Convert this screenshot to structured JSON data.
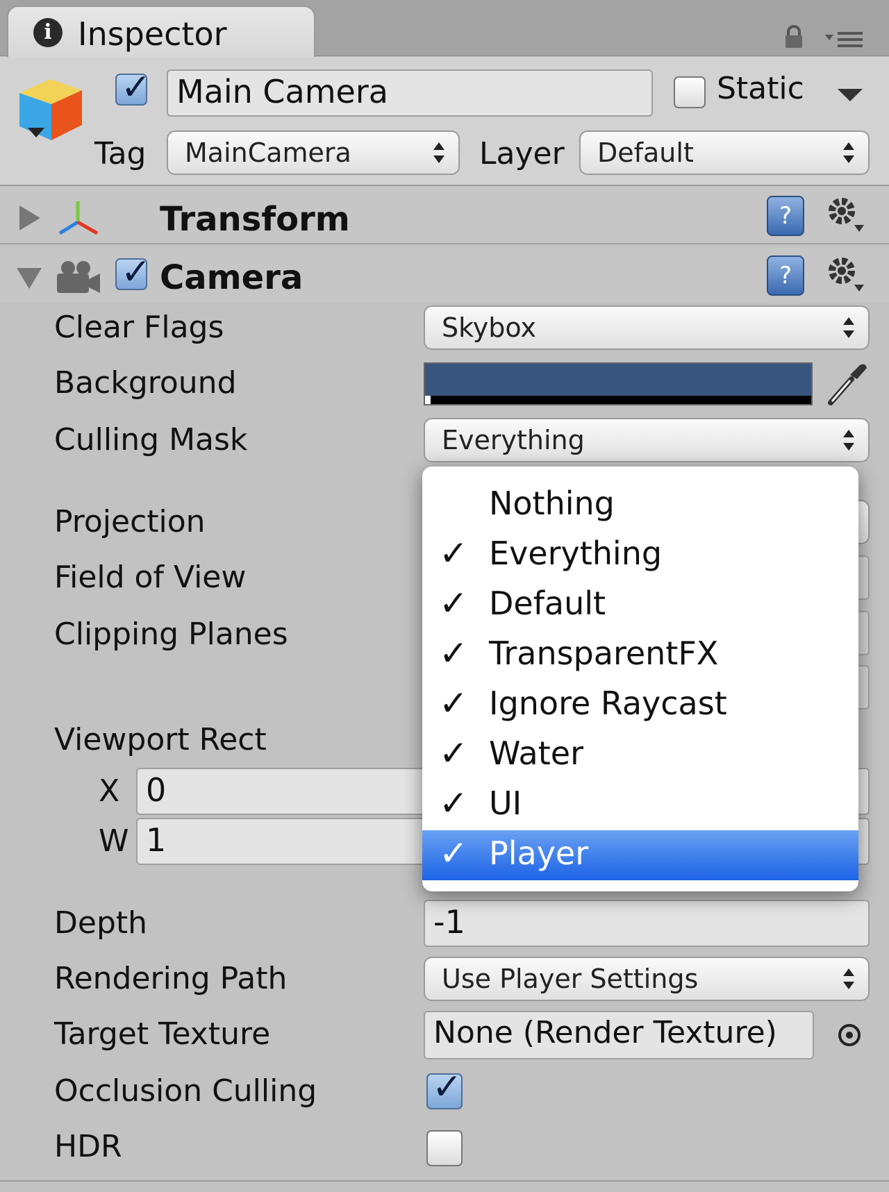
{
  "tab": {
    "title": "Inspector",
    "info_glyph": "i"
  },
  "header": {
    "active": true,
    "object_name": "Main Camera",
    "static_label": "Static",
    "static_checked": false,
    "tag_label": "Tag",
    "tag_value": "MainCamera",
    "layer_label": "Layer",
    "layer_value": "Default"
  },
  "transform": {
    "title": "Transform",
    "help_glyph": "?"
  },
  "camera": {
    "title": "Camera",
    "enabled": true,
    "help_glyph": "?",
    "clear_flags_label": "Clear Flags",
    "clear_flags_value": "Skybox",
    "background_label": "Background",
    "background_color": "#38557e",
    "culling_mask_label": "Culling Mask",
    "culling_mask_value": "Everything",
    "projection_label": "Projection",
    "fov_label": "Field of View",
    "clipping_label": "Clipping Planes",
    "viewport_label": "Viewport Rect",
    "viewport_x_label": "X",
    "viewport_x_value": "0",
    "viewport_w_label": "W",
    "viewport_w_value": "1",
    "depth_label": "Depth",
    "depth_value": "-1",
    "rendering_path_label": "Rendering Path",
    "rendering_path_value": "Use Player Settings",
    "target_texture_label": "Target Texture",
    "target_texture_value": "None (Render Texture)",
    "occlusion_label": "Occlusion Culling",
    "occlusion_checked": true,
    "hdr_label": "HDR",
    "hdr_checked": false
  },
  "culling_menu": {
    "check_glyph": "✓",
    "items": [
      {
        "label": "Nothing",
        "checked": false,
        "selected": false
      },
      {
        "label": "Everything",
        "checked": true,
        "selected": false
      },
      {
        "label": "Default",
        "checked": true,
        "selected": false
      },
      {
        "label": "TransparentFX",
        "checked": true,
        "selected": false
      },
      {
        "label": "Ignore Raycast",
        "checked": true,
        "selected": false
      },
      {
        "label": "Water",
        "checked": true,
        "selected": false
      },
      {
        "label": "UI",
        "checked": true,
        "selected": false
      },
      {
        "label": "Player",
        "checked": true,
        "selected": true
      }
    ]
  },
  "colors": {
    "selection_top": "#6aa1f3",
    "selection_bottom": "#1c63e6"
  }
}
